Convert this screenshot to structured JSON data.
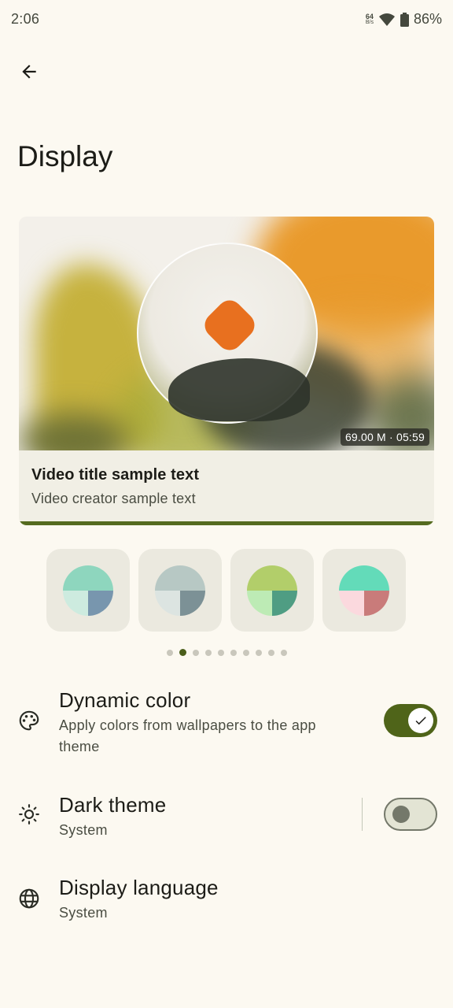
{
  "status_bar": {
    "time": "2:06",
    "net_speed_value": "64",
    "net_speed_unit": "B/s",
    "battery": "86%"
  },
  "header": {
    "back_icon": "arrow-back-icon",
    "title": "Display"
  },
  "video_preview": {
    "duration_badge": "69.00 M · 05:59",
    "title": "Video title sample text",
    "creator": "Video creator sample text",
    "progress": 1.0,
    "progress_color": "#556B1F"
  },
  "palettes": [
    {
      "top": "#8ED6BE",
      "bottom_left": "#CDEBDF",
      "bottom_right": "#7896AE"
    },
    {
      "top": "#B7C8C4",
      "bottom_left": "#DCE4E1",
      "bottom_right": "#7C9196"
    },
    {
      "top": "#B2CE6A",
      "bottom_left": "#BDEBB5",
      "bottom_right": "#4F9D83"
    },
    {
      "top": "#63DBB9",
      "bottom_left": "#FBD9DE",
      "bottom_right": "#C97B7A"
    }
  ],
  "pager": {
    "count": 10,
    "active_index": 1
  },
  "settings": {
    "dynamic_color": {
      "icon": "palette-icon",
      "title": "Dynamic color",
      "subtitle_line1": "Apply colors from wallpapers to the app",
      "subtitle_line2": "theme",
      "enabled": true
    },
    "dark_theme": {
      "icon": "brightness-icon",
      "title": "Dark theme",
      "subtitle": "System",
      "enabled": false
    },
    "display_language": {
      "icon": "globe-icon",
      "title": "Display language",
      "subtitle": "System"
    }
  },
  "colors": {
    "background": "#FCF9F1",
    "accent": "#4F6419"
  }
}
